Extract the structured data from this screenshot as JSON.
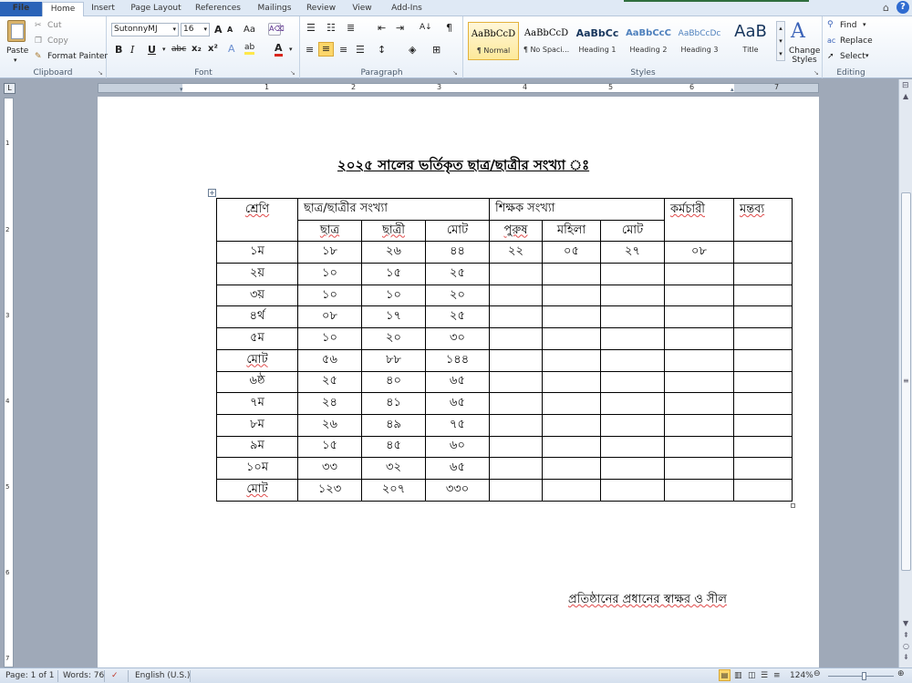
{
  "tabs": {
    "file": "File",
    "home": "Home",
    "insert": "Insert",
    "page_layout": "Page Layout",
    "references": "References",
    "mailings": "Mailings",
    "review": "Review",
    "view": "View",
    "addins": "Add-Ins"
  },
  "clipboard": {
    "paste": "Paste",
    "cut": "Cut",
    "copy": "Copy",
    "format_painter": "Format Painter",
    "label": "Clipboard"
  },
  "font": {
    "family": "SutonnyMJ",
    "size": "16",
    "grow": "A",
    "shrink": "A",
    "change_case": "Aa",
    "bold": "B",
    "italic": "I",
    "underline": "U",
    "strike": "abc",
    "subscript": "x₂",
    "superscript": "x²",
    "highlight": "ab",
    "font_color": "A",
    "label": "Font"
  },
  "paragraph": {
    "sort": "A↓",
    "pilcrow": "¶",
    "label": "Paragraph"
  },
  "styles": {
    "items": [
      {
        "sample": "AaBbCcD",
        "name": "¶ Normal"
      },
      {
        "sample": "AaBbCcD",
        "name": "¶ No Spaci..."
      },
      {
        "sample": "AaBbCc",
        "name": "Heading 1"
      },
      {
        "sample": "AaBbCcC",
        "name": "Heading 2"
      },
      {
        "sample": "AaBbCcDc",
        "name": "Heading 3"
      },
      {
        "sample": "AaB",
        "name": "Title"
      }
    ],
    "change_styles": "Change Styles",
    "label": "Styles"
  },
  "editing": {
    "find": "Find",
    "replace": "Replace",
    "select": "Select",
    "label": "Editing"
  },
  "colors": {
    "file_tab": "#2a63b8",
    "ribbon_bg": "#e9f0f8",
    "workspace_bg": "#9fa9b8",
    "page_bg": "#ffffff",
    "selected_style_border": "#e3b23c"
  },
  "document": {
    "title": "২০২৫ সালের ভর্তিকৃত ছাত্র/ছাত্রীর সংখ্যা ঃ",
    "table": {
      "header_row1": {
        "class": "শ্রেণি",
        "student_count": "ছাত্র/ছাত্রীর সংখ্যা",
        "teacher_count": "শিক্ষক সংখ্যা",
        "staff": "কর্মচারী",
        "remarks": "মন্তব্য"
      },
      "header_row2": {
        "boys": "ছাত্র",
        "girls": "ছাত্রী",
        "total": "মোট",
        "male": "পুরুষ",
        "female": "মহিলা",
        "teacher_total": "মোট"
      },
      "rows": [
        {
          "class": "১ম",
          "boys": "১৮",
          "girls": "২৬",
          "total": "৪৪",
          "male": "২২",
          "female": "০৫",
          "teacher_total": "২৭",
          "staff": "০৮",
          "remarks": ""
        },
        {
          "class": "২য়",
          "boys": "১০",
          "girls": "১৫",
          "total": "২৫",
          "male": "",
          "female": "",
          "teacher_total": "",
          "staff": "",
          "remarks": ""
        },
        {
          "class": "৩য়",
          "boys": "১০",
          "girls": "১০",
          "total": "২০",
          "male": "",
          "female": "",
          "teacher_total": "",
          "staff": "",
          "remarks": ""
        },
        {
          "class": "৪র্থ",
          "boys": "০৮",
          "girls": "১৭",
          "total": "২৫",
          "male": "",
          "female": "",
          "teacher_total": "",
          "staff": "",
          "remarks": ""
        },
        {
          "class": "৫ম",
          "boys": "১০",
          "girls": "২০",
          "total": "৩০",
          "male": "",
          "female": "",
          "teacher_total": "",
          "staff": "",
          "remarks": ""
        },
        {
          "class": "মোট",
          "boys": "৫৬",
          "girls": "৮৮",
          "total": "১৪৪",
          "male": "",
          "female": "",
          "teacher_total": "",
          "staff": "",
          "remarks": ""
        },
        {
          "class": "৬ষ্ঠ",
          "boys": "২৫",
          "girls": "৪০",
          "total": "৬৫",
          "male": "",
          "female": "",
          "teacher_total": "",
          "staff": "",
          "remarks": ""
        },
        {
          "class": "৭ম",
          "boys": "২৪",
          "girls": "৪১",
          "total": "৬৫",
          "male": "",
          "female": "",
          "teacher_total": "",
          "staff": "",
          "remarks": ""
        },
        {
          "class": "৮ম",
          "boys": "২৬",
          "girls": "৪৯",
          "total": "৭৫",
          "male": "",
          "female": "",
          "teacher_total": "",
          "staff": "",
          "remarks": ""
        },
        {
          "class": "৯ম",
          "boys": "১৫",
          "girls": "৪৫",
          "total": "৬০",
          "male": "",
          "female": "",
          "teacher_total": "",
          "staff": "",
          "remarks": ""
        },
        {
          "class": "১০ম",
          "boys": "৩৩",
          "girls": "৩২",
          "total": "৬৫",
          "male": "",
          "female": "",
          "teacher_total": "",
          "staff": "",
          "remarks": ""
        },
        {
          "class": "মোট",
          "boys": "১২৩",
          "girls": "২০৭",
          "total": "৩৩০",
          "male": "",
          "female": "",
          "teacher_total": "",
          "staff": "",
          "remarks": ""
        }
      ]
    },
    "signature": "প্রতিষ্ঠানের প্রধানের স্বাক্ষর ও সীল"
  },
  "ruler": {
    "h_numbers": [
      "1",
      "2",
      "3",
      "4",
      "5",
      "6",
      "7"
    ],
    "v_numbers": [
      "1",
      "2",
      "3",
      "4",
      "5",
      "6",
      "7"
    ]
  },
  "status": {
    "page": "Page: 1 of 1",
    "words": "Words: 76",
    "language": "English (U.S.)",
    "zoom": "124%"
  }
}
